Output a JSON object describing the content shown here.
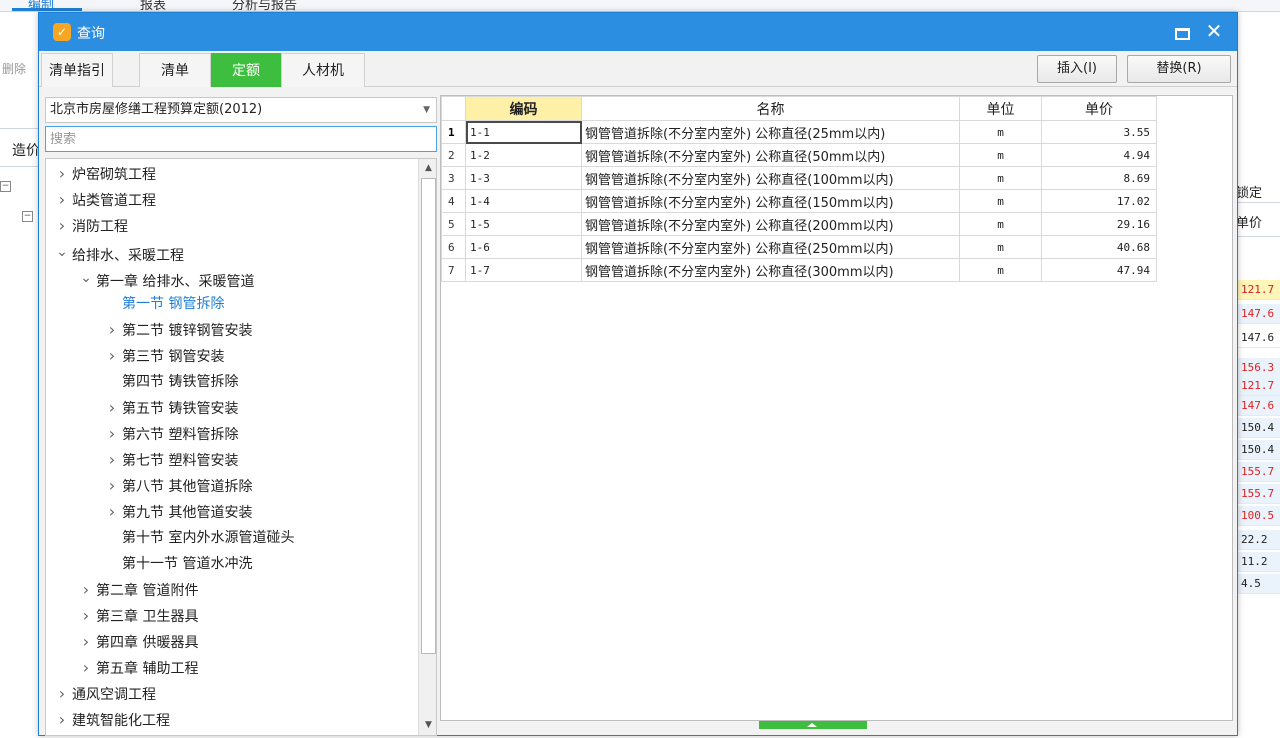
{
  "background": {
    "tabs": [
      "编制",
      "报表",
      "分析与报告"
    ],
    "toolbar_delete": "删除",
    "side_label": "造价",
    "right_header_top": "锁定",
    "right_header_bottom": "单价",
    "right_values": [
      {
        "v": "121.7",
        "style": "hl"
      },
      {
        "v": "147.6",
        "style": "red"
      },
      {
        "v": "147.6",
        "style": "plain"
      },
      {
        "v": "156.3",
        "style": "red"
      },
      {
        "v": "121.7",
        "style": "red"
      },
      {
        "v": "147.6",
        "style": "red"
      },
      {
        "v": "150.4",
        "style": "black"
      },
      {
        "v": "150.4",
        "style": "black"
      },
      {
        "v": "155.7",
        "style": "red"
      },
      {
        "v": "155.7",
        "style": "red"
      },
      {
        "v": "100.5",
        "style": "red"
      },
      {
        "v": "22.2",
        "style": "black"
      },
      {
        "v": "11.2",
        "style": "black"
      },
      {
        "v": "4.5",
        "style": "black"
      }
    ]
  },
  "dialog": {
    "title": "查询",
    "icons": {
      "logo": "app-logo-icon",
      "maximize": "maximize-icon",
      "close": "close-icon"
    },
    "close_glyph": "✕",
    "tabs": [
      {
        "label": "清单指引",
        "active": false
      },
      {
        "label": "清单",
        "active": false
      },
      {
        "label": "定额",
        "active": true
      },
      {
        "label": "人材机",
        "active": false
      }
    ],
    "insert_button": "插入(I)",
    "replace_button": "替换(R)"
  },
  "left": {
    "library": "北京市房屋修缮工程预算定额(2012)",
    "search_placeholder": "搜索",
    "search_value": "",
    "tree": [
      {
        "label": "炉窑砌筑工程",
        "level": 0,
        "chev": "right"
      },
      {
        "label": "站类管道工程",
        "level": 0,
        "chev": "right"
      },
      {
        "label": "消防工程",
        "level": 0,
        "chev": "right"
      },
      {
        "label": "给排水、采暖工程",
        "level": 0,
        "chev": "down"
      },
      {
        "label": "第一章 给排水、采暖管道",
        "level": 1,
        "chev": "down"
      },
      {
        "label": "第一节 钢管拆除",
        "level": 2,
        "chev": "none",
        "selected": true
      },
      {
        "label": "第二节 镀锌钢管安装",
        "level": 2,
        "chev": "right"
      },
      {
        "label": "第三节 钢管安装",
        "level": 2,
        "chev": "right"
      },
      {
        "label": "第四节 铸铁管拆除",
        "level": 2,
        "chev": "none"
      },
      {
        "label": "第五节 铸铁管安装",
        "level": 2,
        "chev": "right"
      },
      {
        "label": "第六节 塑料管拆除",
        "level": 2,
        "chev": "right"
      },
      {
        "label": "第七节 塑料管安装",
        "level": 2,
        "chev": "right"
      },
      {
        "label": "第八节 其他管道拆除",
        "level": 2,
        "chev": "right"
      },
      {
        "label": "第九节 其他管道安装",
        "level": 2,
        "chev": "right"
      },
      {
        "label": "第十节 室内外水源管道碰头",
        "level": 2,
        "chev": "none"
      },
      {
        "label": "第十一节 管道水冲洗",
        "level": 2,
        "chev": "none"
      },
      {
        "label": "第二章 管道附件",
        "level": 1,
        "chev": "right"
      },
      {
        "label": "第三章 卫生器具",
        "level": 1,
        "chev": "right"
      },
      {
        "label": "第四章 供暖器具",
        "level": 1,
        "chev": "right"
      },
      {
        "label": "第五章 辅助工程",
        "level": 1,
        "chev": "right"
      },
      {
        "label": "通风空调工程",
        "level": 0,
        "chev": "right"
      },
      {
        "label": "建筑智能化工程",
        "level": 0,
        "chev": "right"
      }
    ]
  },
  "table": {
    "columns": [
      "编码",
      "名称",
      "单位",
      "单价"
    ],
    "rows": [
      {
        "no": "1",
        "code": "1-1",
        "name": "钢管管道拆除(不分室内室外) 公称直径(25mm以内)",
        "unit": "m",
        "price": "3.55"
      },
      {
        "no": "2",
        "code": "1-2",
        "name": "钢管管道拆除(不分室内室外) 公称直径(50mm以内)",
        "unit": "m",
        "price": "4.94"
      },
      {
        "no": "3",
        "code": "1-3",
        "name": "钢管管道拆除(不分室内室外) 公称直径(100mm以内)",
        "unit": "m",
        "price": "8.69"
      },
      {
        "no": "4",
        "code": "1-4",
        "name": "钢管管道拆除(不分室内室外) 公称直径(150mm以内)",
        "unit": "m",
        "price": "17.02"
      },
      {
        "no": "5",
        "code": "1-5",
        "name": "钢管管道拆除(不分室内室外) 公称直径(200mm以内)",
        "unit": "m",
        "price": "29.16"
      },
      {
        "no": "6",
        "code": "1-6",
        "name": "钢管管道拆除(不分室内室外) 公称直径(250mm以内)",
        "unit": "m",
        "price": "40.68"
      },
      {
        "no": "7",
        "code": "1-7",
        "name": "钢管管道拆除(不分室内室外) 公称直径(300mm以内)",
        "unit": "m",
        "price": "47.94"
      }
    ],
    "current_row": 0
  }
}
